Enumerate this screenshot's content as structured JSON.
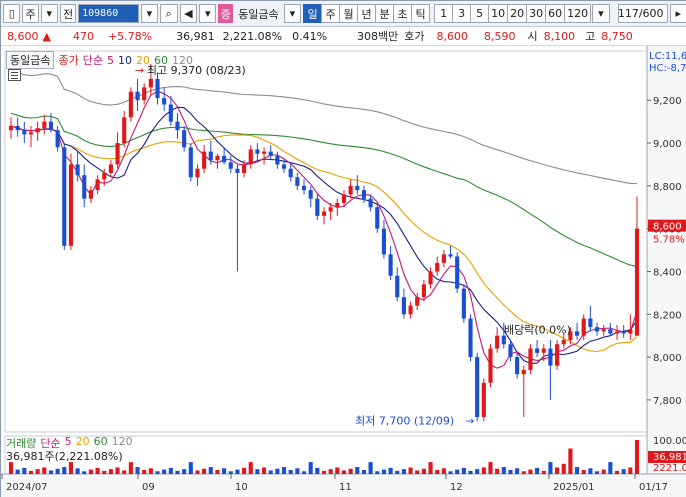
{
  "toolbar": {
    "market_toggle": "주",
    "jeon_label": "전",
    "stock_code": "109860",
    "badge": "증",
    "stock_name": "동일금속",
    "period_buttons": [
      "일",
      "주",
      "월",
      "년",
      "분",
      "초",
      "틱"
    ],
    "active_period": "일",
    "interval_buttons": [
      "1",
      "3",
      "5",
      "10",
      "20",
      "30",
      "60",
      "120"
    ],
    "count": "117/600"
  },
  "info": {
    "price": "8,600",
    "change_arrow": "▲",
    "change": "470",
    "change_pct": "+5.78%",
    "volume": "36,981",
    "volume_ratio": "2,221.08%",
    "turnover_pct": "0.41%",
    "amount": "308백만",
    "quote_label": "호가",
    "ask": "8,600",
    "bid": "8,590",
    "open_label": "시",
    "open": "8,100",
    "high_label": "고",
    "high": "8,750"
  },
  "legend": {
    "name": "동일금속",
    "price_label": "종가",
    "ma_type": "단순",
    "ma_periods": [
      "5",
      "10",
      "20",
      "60",
      "120"
    ],
    "volume_label": "거래량",
    "volume_value": "36,981주(2,221.08%)"
  },
  "colors": {
    "up": "#e0181b",
    "down": "#1a4fd1",
    "ma5": "#c2187a",
    "ma10": "#1b1f8c",
    "ma20": "#e8a000",
    "ma60": "#2e8b2e",
    "ma120": "#8c8c8c"
  },
  "chart_data": {
    "type": "candlestick",
    "price_axis": {
      "ticks": [
        "9,200",
        "9,000",
        "8,800",
        "8,600",
        "8,400",
        "8,200",
        "8,000",
        "7,800"
      ]
    },
    "x_labels": [
      "2024/07",
      "09",
      "10",
      "11",
      "12",
      "2025/01",
      "01/17"
    ],
    "annotations": {
      "high": "최고 9,370 (08/23)",
      "low": "최저 7,700 (12/09)",
      "dividend": "배당락(0.0%)",
      "lc": "LC:11,6",
      "hc": "HC:-8,7",
      "last_price": "8,600",
      "last_pct": "5.78%"
    },
    "volume_axis": {
      "ticks": [
        "100.00",
        "36,981",
        "2221.0"
      ]
    },
    "ohlc": [
      [
        9060,
        9120,
        9020,
        9080
      ],
      [
        9080,
        9120,
        9030,
        9060
      ],
      [
        9060,
        9100,
        9000,
        9040
      ],
      [
        9040,
        9080,
        8980,
        9050
      ],
      [
        9050,
        9100,
        9010,
        9070
      ],
      [
        9070,
        9130,
        9040,
        9100
      ],
      [
        9100,
        9140,
        9050,
        9060
      ],
      [
        9060,
        9080,
        8960,
        8980
      ],
      [
        8980,
        9000,
        8500,
        8520
      ],
      [
        8520,
        8950,
        8500,
        8900
      ],
      [
        8900,
        8960,
        8820,
        8850
      ],
      [
        8850,
        8900,
        8700,
        8740
      ],
      [
        8740,
        8800,
        8720,
        8780
      ],
      [
        8780,
        8850,
        8760,
        8830
      ],
      [
        8830,
        8880,
        8800,
        8860
      ],
      [
        8860,
        8920,
        8840,
        8900
      ],
      [
        8900,
        9050,
        8880,
        9000
      ],
      [
        9000,
        9150,
        8980,
        9120
      ],
      [
        9120,
        9260,
        9100,
        9240
      ],
      [
        9240,
        9300,
        9150,
        9200
      ],
      [
        9200,
        9280,
        9180,
        9260
      ],
      [
        9260,
        9370,
        9220,
        9300
      ],
      [
        9300,
        9330,
        9180,
        9210
      ],
      [
        9210,
        9260,
        9150,
        9180
      ],
      [
        9180,
        9220,
        9080,
        9100
      ],
      [
        9100,
        9140,
        9020,
        9060
      ],
      [
        9060,
        9080,
        8960,
        8980
      ],
      [
        8980,
        9000,
        8820,
        8840
      ],
      [
        8840,
        8900,
        8800,
        8880
      ],
      [
        8880,
        8990,
        8860,
        8960
      ],
      [
        8960,
        9010,
        8900,
        8920
      ],
      [
        8920,
        8950,
        8880,
        8940
      ],
      [
        8940,
        8980,
        8900,
        8910
      ],
      [
        8910,
        8940,
        8860,
        8880
      ],
      [
        8880,
        8900,
        8400,
        8860
      ],
      [
        8860,
        8920,
        8840,
        8900
      ],
      [
        8900,
        8990,
        8880,
        8970
      ],
      [
        8970,
        9000,
        8920,
        8950
      ],
      [
        8950,
        8980,
        8900,
        8960
      ],
      [
        8960,
        8990,
        8920,
        8940
      ],
      [
        8940,
        8960,
        8880,
        8900
      ],
      [
        8900,
        8920,
        8860,
        8880
      ],
      [
        8880,
        8900,
        8820,
        8840
      ],
      [
        8840,
        8860,
        8780,
        8800
      ],
      [
        8800,
        8830,
        8760,
        8780
      ],
      [
        8780,
        8800,
        8700,
        8740
      ],
      [
        8740,
        8760,
        8640,
        8660
      ],
      [
        8660,
        8700,
        8620,
        8680
      ],
      [
        8680,
        8720,
        8640,
        8700
      ],
      [
        8700,
        8740,
        8660,
        8720
      ],
      [
        8720,
        8780,
        8700,
        8760
      ],
      [
        8760,
        8830,
        8740,
        8800
      ],
      [
        8800,
        8850,
        8760,
        8780
      ],
      [
        8780,
        8800,
        8720,
        8740
      ],
      [
        8740,
        8760,
        8680,
        8700
      ],
      [
        8700,
        8720,
        8580,
        8600
      ],
      [
        8600,
        8640,
        8460,
        8480
      ],
      [
        8480,
        8520,
        8360,
        8380
      ],
      [
        8380,
        8420,
        8260,
        8280
      ],
      [
        8280,
        8320,
        8180,
        8200
      ],
      [
        8200,
        8260,
        8180,
        8240
      ],
      [
        8240,
        8300,
        8220,
        8280
      ],
      [
        8280,
        8360,
        8260,
        8340
      ],
      [
        8340,
        8420,
        8320,
        8400
      ],
      [
        8400,
        8470,
        8380,
        8440
      ],
      [
        8440,
        8500,
        8420,
        8480
      ],
      [
        8480,
        8520,
        8460,
        8470
      ],
      [
        8470,
        8490,
        8300,
        8320
      ],
      [
        8320,
        8340,
        8160,
        8180
      ],
      [
        8180,
        8200,
        7980,
        8000
      ],
      [
        8000,
        8020,
        7700,
        7720
      ],
      [
        7720,
        7900,
        7700,
        7880
      ],
      [
        7880,
        8060,
        7860,
        8040
      ],
      [
        8040,
        8140,
        8020,
        8100
      ],
      [
        8100,
        8160,
        8040,
        8060
      ],
      [
        8060,
        8080,
        7980,
        8000
      ],
      [
        8000,
        8020,
        7900,
        7920
      ],
      [
        7920,
        7960,
        7720,
        7940
      ],
      [
        7940,
        8060,
        7920,
        8040
      ],
      [
        8040,
        8080,
        8000,
        8020
      ],
      [
        8020,
        8060,
        7980,
        8040
      ],
      [
        8040,
        8080,
        7800,
        7960
      ],
      [
        7960,
        8080,
        7940,
        8060
      ],
      [
        8060,
        8110,
        8040,
        8080
      ],
      [
        8080,
        8140,
        8060,
        8120
      ],
      [
        8120,
        8160,
        8080,
        8100
      ],
      [
        8100,
        8200,
        8080,
        8180
      ],
      [
        8180,
        8240,
        8120,
        8140
      ],
      [
        8140,
        8160,
        8100,
        8120
      ],
      [
        8120,
        8150,
        8100,
        8130
      ],
      [
        8130,
        8160,
        8100,
        8110
      ],
      [
        8110,
        8150,
        8080,
        8120
      ],
      [
        8120,
        8150,
        8090,
        8110
      ],
      [
        8110,
        8200,
        8080,
        8130
      ],
      [
        8100,
        8750,
        8100,
        8600
      ]
    ]
  }
}
